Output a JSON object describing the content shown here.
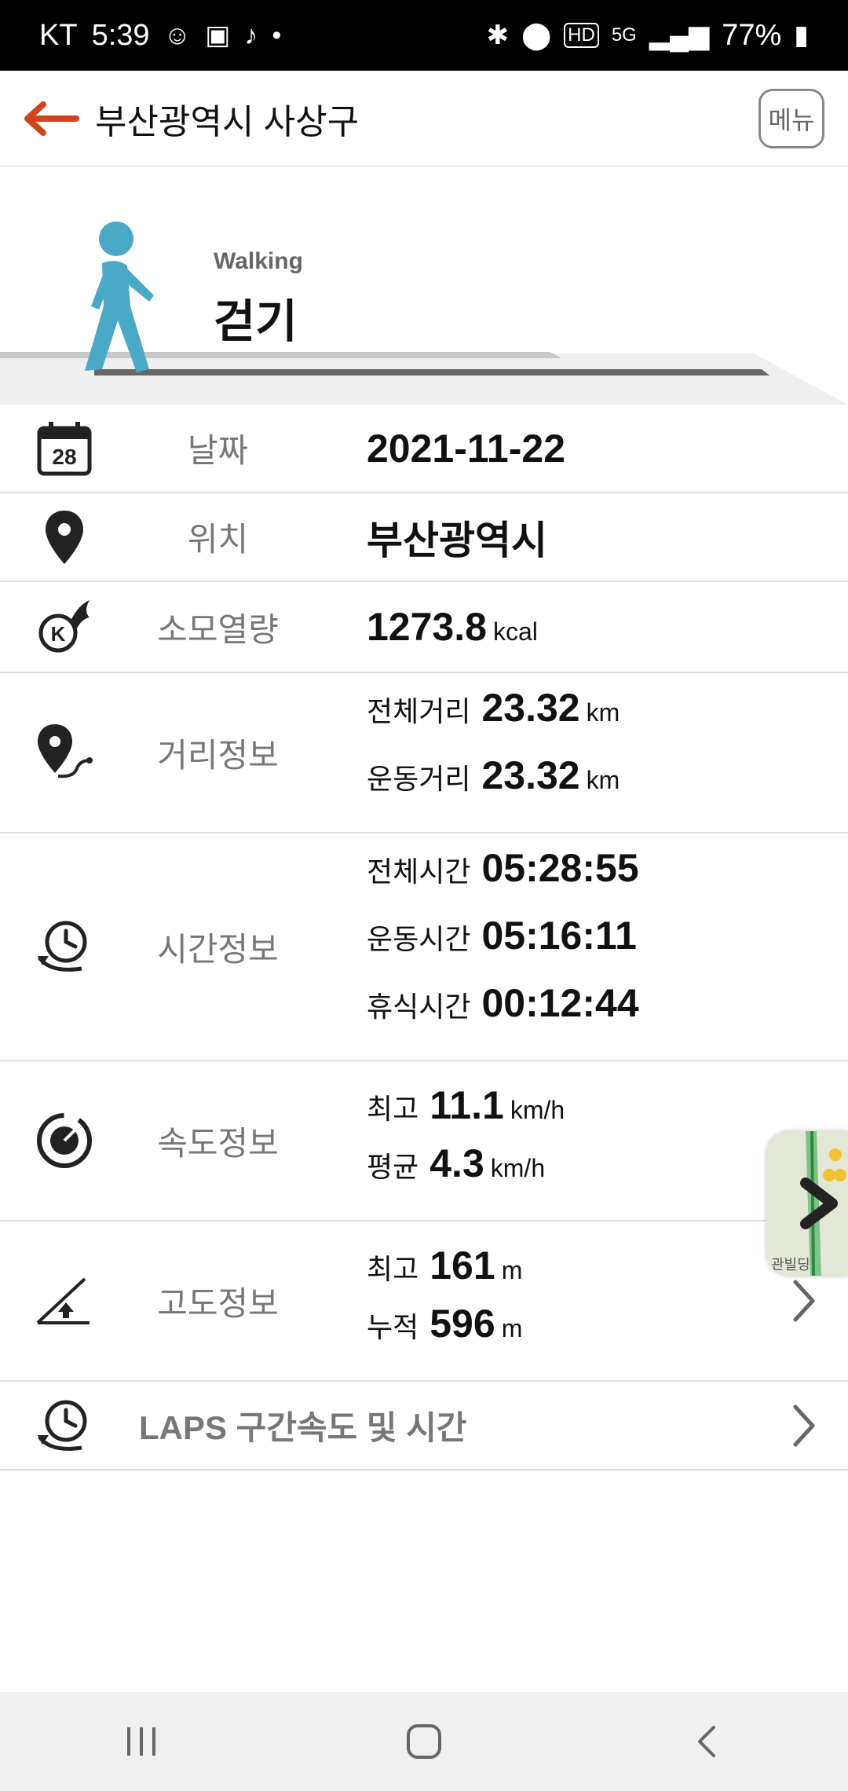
{
  "status_bar": {
    "carrier": "KT",
    "time": "5:39",
    "battery": "77%",
    "icons_left": [
      "notification-icon",
      "gallery-icon",
      "tiktok-icon",
      "dot-icon"
    ],
    "icons_right": [
      "bluetooth-icon",
      "location-icon",
      "hd-icon",
      "5g-icon",
      "signal-icon",
      "battery-icon"
    ]
  },
  "app_bar": {
    "title": "부산광역시 사상구",
    "menu_label": "메뉴"
  },
  "activity": {
    "label_en": "Walking",
    "label_ko": "걷기"
  },
  "rows": {
    "date": {
      "label": "날짜",
      "value": "2021-11-22",
      "icon": "calendar-icon",
      "calendar_day": "28"
    },
    "location": {
      "label": "위치",
      "value": "부산광역시",
      "icon": "location-pin-icon"
    },
    "calories": {
      "label": "소모열량",
      "value": "1273.8",
      "unit": "kcal",
      "icon": "calorie-icon"
    },
    "distance": {
      "label": "거리정보",
      "total_label": "전체거리",
      "total_value": "23.32",
      "total_unit": "km",
      "exercise_label": "운동거리",
      "exercise_value": "23.32",
      "exercise_unit": "km",
      "icon": "route-icon"
    },
    "time": {
      "label": "시간정보",
      "total_label": "전체시간",
      "total_value": "05:28:55",
      "exercise_label": "운동시간",
      "exercise_value": "05:16:11",
      "rest_label": "휴식시간",
      "rest_value": "00:12:44",
      "icon": "clock-icon"
    },
    "speed": {
      "label": "속도정보",
      "max_label": "최고",
      "max_value": "11.1",
      "max_unit": "km/h",
      "avg_label": "평균",
      "avg_value": "4.3",
      "avg_unit": "km/h",
      "icon": "speedometer-icon"
    },
    "altitude": {
      "label": "고도정보",
      "max_label": "최고",
      "max_value": "161",
      "max_unit": "m",
      "cum_label": "누적",
      "cum_value": "596",
      "cum_unit": "m",
      "icon": "altitude-icon"
    },
    "laps": {
      "label": "LAPS 구간속도 및 시간",
      "icon": "laps-clock-icon"
    }
  },
  "map_thumb": {
    "text": "관빌딩"
  },
  "colors": {
    "accent": "#d0451b",
    "walker": "#4ba9c8",
    "label": "#777777"
  }
}
